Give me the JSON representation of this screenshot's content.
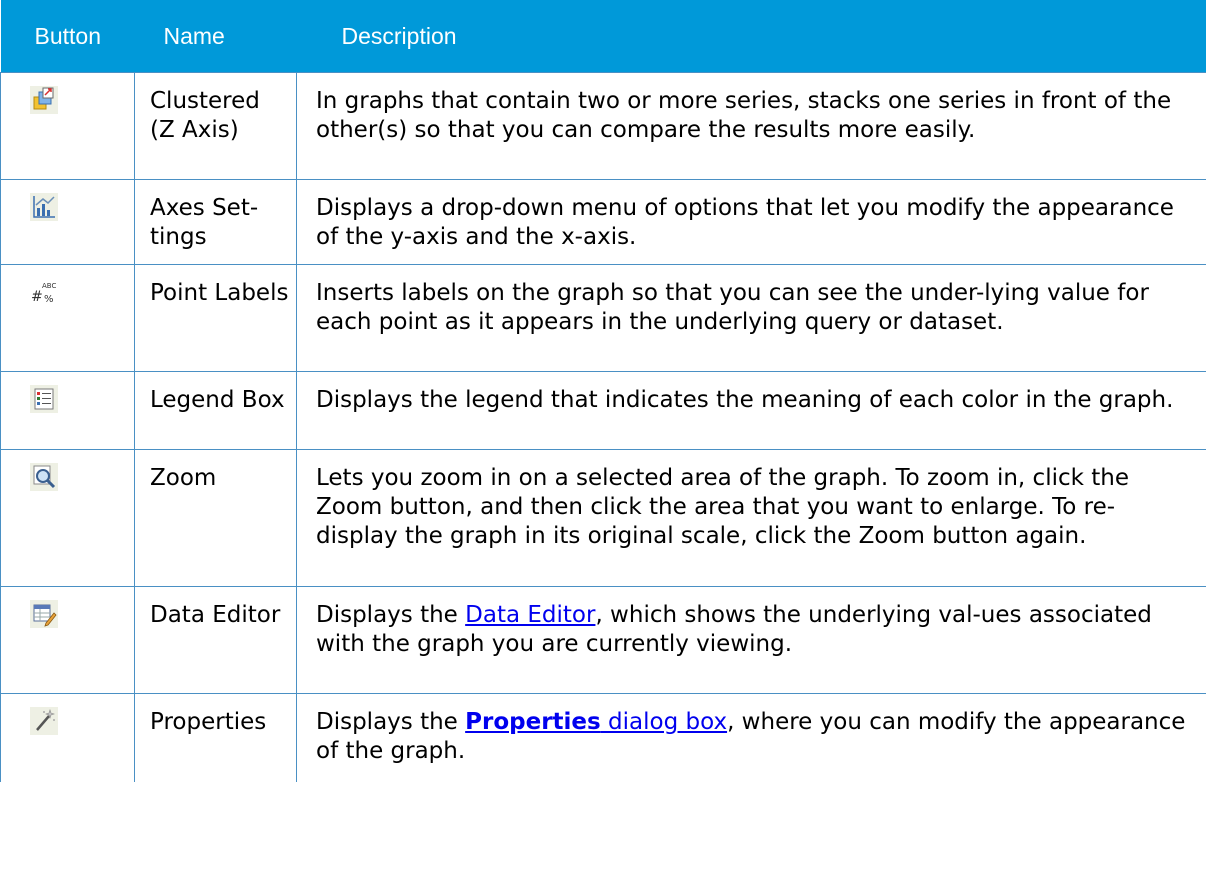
{
  "header": {
    "col_button": "Button",
    "col_name": "Name",
    "col_description": "Description"
  },
  "rows": [
    {
      "icon": "clustered-z-axis-icon",
      "name": "Clustered (Z Axis)",
      "description": "In graphs that contain two or more series, stacks one series in front of the other(s) so that you can compare the results more easily."
    },
    {
      "icon": "axes-settings-icon",
      "name": "Axes Set-tings",
      "description": "Displays a drop-down menu of options that let you modify the appearance of the y-axis and the x-axis."
    },
    {
      "icon": "point-labels-icon",
      "name": "Point Labels",
      "description": "Inserts labels on the graph so that you can see the under-lying value for each point as it appears in the underlying query or dataset."
    },
    {
      "icon": "legend-box-icon",
      "name": "Legend Box",
      "description": "Displays the legend that indicates the meaning of each color in the graph."
    },
    {
      "icon": "zoom-icon",
      "name": "Zoom",
      "description": "Lets you zoom in on a selected area of the graph. To zoom in, click the Zoom button, and then click the area that you want to enlarge. To re-display the graph in its original scale, click the Zoom button again."
    },
    {
      "icon": "data-editor-icon",
      "name": "Data Editor",
      "description_before": "Displays the ",
      "description_link": "Data Editor",
      "description_after": ", which shows the underlying val-ues associated with the graph you are currently viewing."
    },
    {
      "icon": "properties-icon",
      "name": "Properties",
      "description_before": "Displays the ",
      "description_link_bold": "Properties",
      "description_link": " dialog box",
      "description_after": ", where you can modify the appearance of the graph."
    }
  ],
  "colors": {
    "header_bg": "#0099d9",
    "header_text": "#ffffff",
    "border": "#4a90c4",
    "link": "#0000ee"
  }
}
